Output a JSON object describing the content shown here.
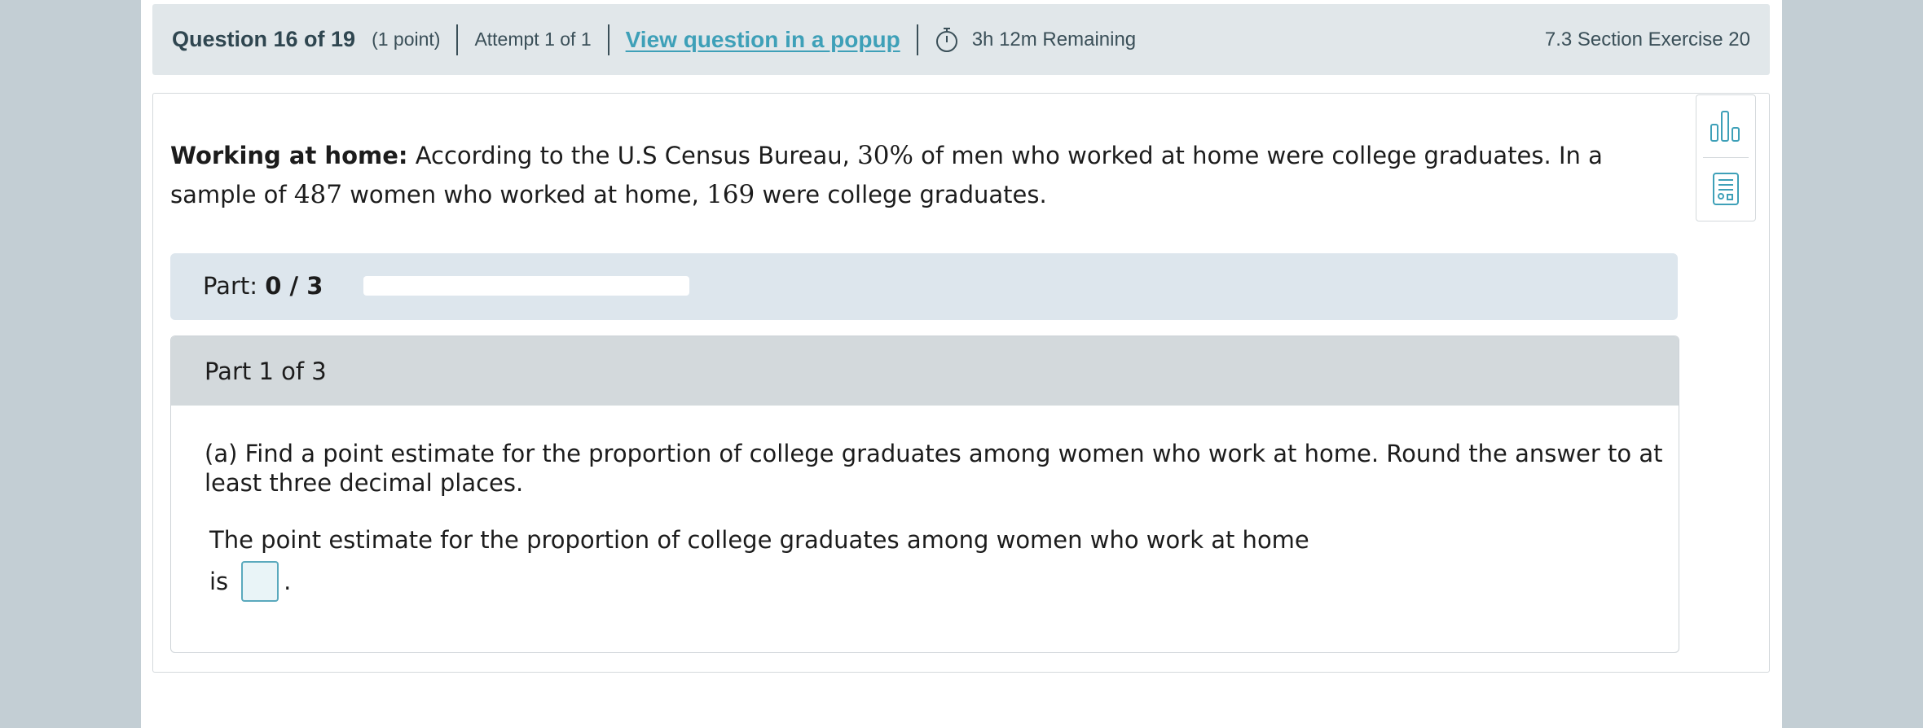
{
  "header": {
    "question_title": "Question 16 of 19",
    "points": "(1 point)",
    "attempt": "Attempt 1 of 1",
    "popup_link": "View question in a popup",
    "timer": "3h 12m Remaining",
    "section": "7.3 Section Exercise 20"
  },
  "problem": {
    "lead": "Working at home:",
    "text1": " According to the U.S Census Bureau, ",
    "percent": "30%",
    "text2": " of men who worked at home were college graduates. In a sample of ",
    "sample_size": "487",
    "text3": " women who worked at home, ",
    "grads": "169",
    "text4": " were college graduates."
  },
  "progress": {
    "label": "Part:",
    "value": "0 / 3",
    "fraction": 0
  },
  "part": {
    "title": "Part 1 of 3",
    "prompt": "(a) Find a point estimate for the proportion of college graduates among women who work at home. Round the answer to at least three decimal places.",
    "answer_line1": "The point estimate for the proportion of college graduates among women who work at home",
    "answer_is": "is",
    "answer_value": "",
    "answer_end": "."
  },
  "tools": {
    "icons": [
      "bar-chart-icon",
      "calculator-icon"
    ]
  }
}
